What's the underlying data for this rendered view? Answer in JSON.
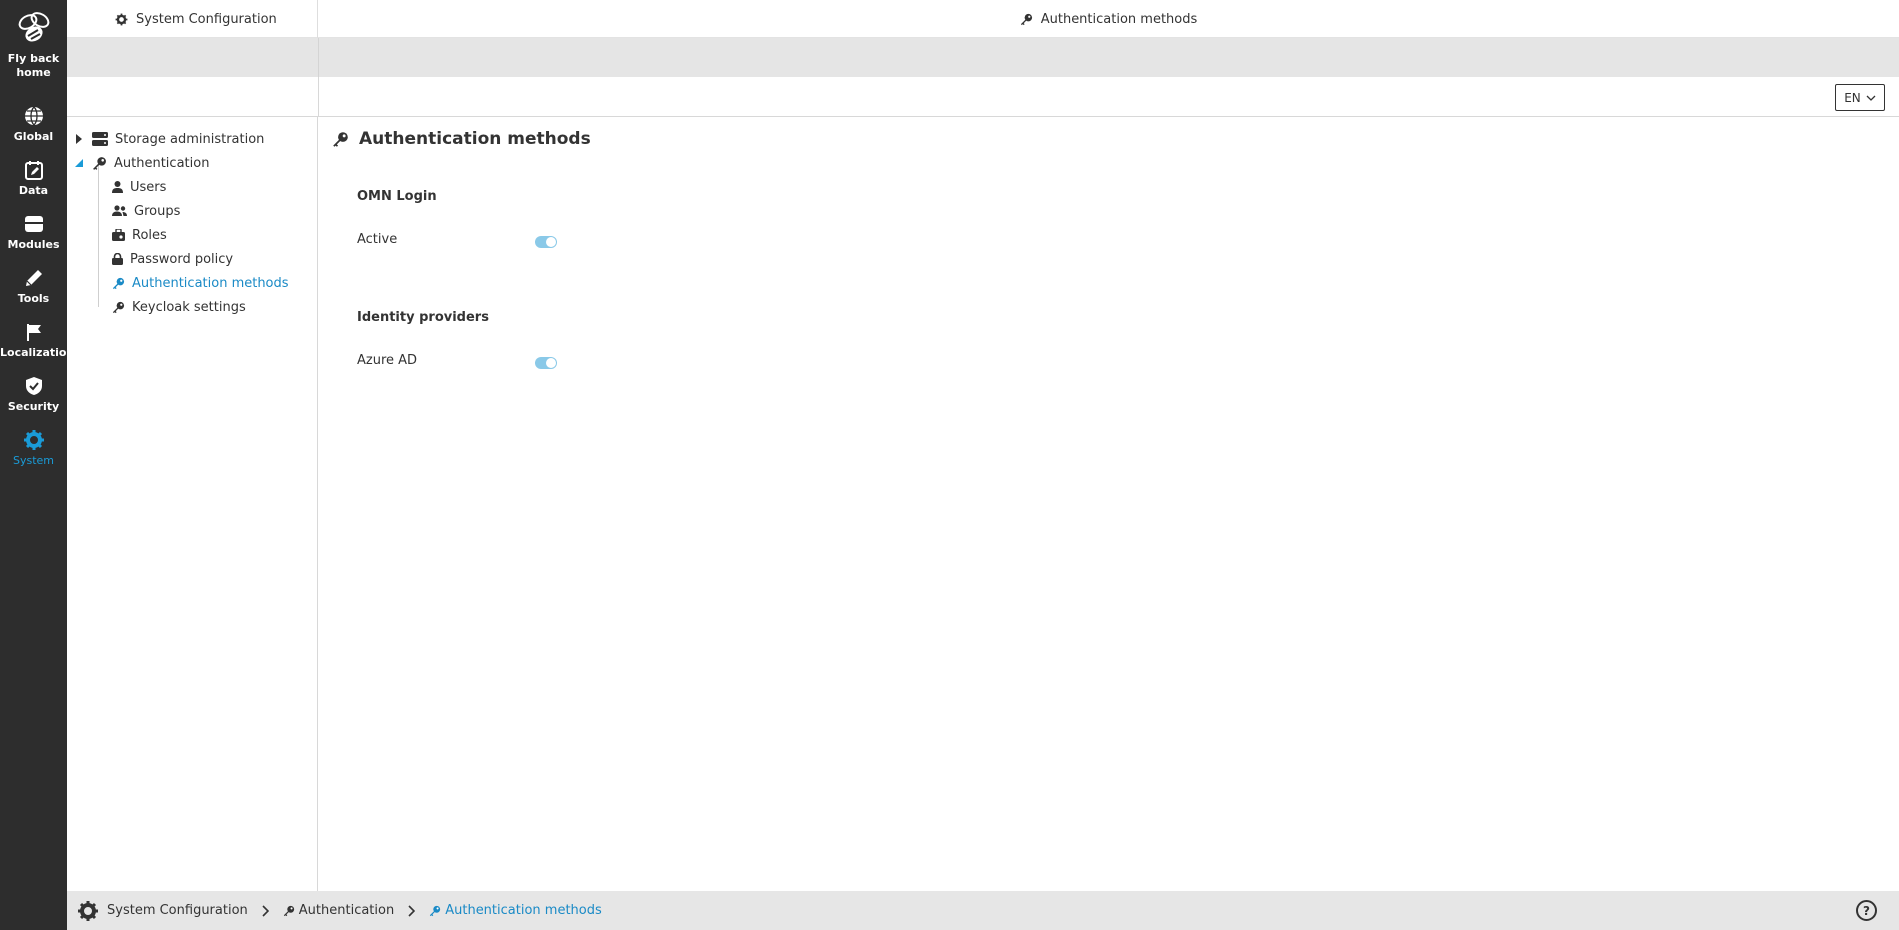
{
  "rail": {
    "logo_label": "Fly back home",
    "items": [
      {
        "label": "Global",
        "icon": "globe-icon"
      },
      {
        "label": "Data",
        "icon": "calendar-edit-icon"
      },
      {
        "label": "Modules",
        "icon": "module-box-icon"
      },
      {
        "label": "Tools",
        "icon": "pencil-icon"
      },
      {
        "label": "Localization",
        "icon": "flag-icon"
      },
      {
        "label": "Security",
        "icon": "shield-check-icon"
      },
      {
        "label": "System",
        "icon": "gear-icon"
      }
    ],
    "active_color": "#1a9bd7"
  },
  "topbar": {
    "left_tab": "System Configuration",
    "center_title": "Authentication methods"
  },
  "language": {
    "selected": "EN"
  },
  "tree": {
    "nodes": [
      {
        "label": "Storage administration",
        "icon": "server-icon"
      },
      {
        "label": "Authentication",
        "icon": "key-icon"
      },
      {
        "label": "Users",
        "icon": "user-icon"
      },
      {
        "label": "Groups",
        "icon": "users-icon"
      },
      {
        "label": "Roles",
        "icon": "roles-icon"
      },
      {
        "label": "Password policy",
        "icon": "lock-icon"
      },
      {
        "label": "Authentication methods",
        "icon": "key-icon"
      },
      {
        "label": "Keycloak settings",
        "icon": "key-icon"
      }
    ],
    "selected": "Authentication methods"
  },
  "content": {
    "title": "Authentication methods",
    "sections": [
      {
        "heading": "OMN Login",
        "rows": [
          {
            "label": "Active",
            "enabled": true
          }
        ]
      },
      {
        "heading": "Identity providers",
        "rows": [
          {
            "label": "Azure AD",
            "enabled": true
          }
        ]
      }
    ]
  },
  "breadcrumb": {
    "items": [
      "System Configuration",
      "Authentication",
      "Authentication methods"
    ]
  },
  "help_label": "?"
}
